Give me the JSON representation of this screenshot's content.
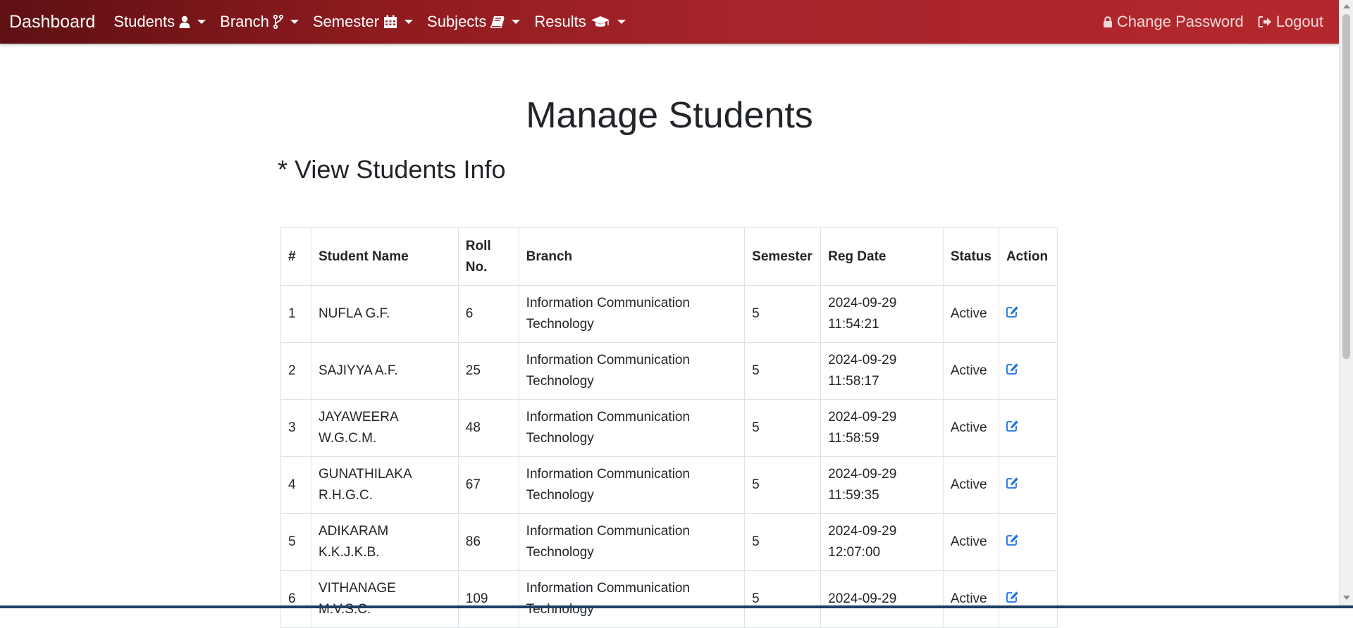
{
  "navbar": {
    "brand": "Dashboard",
    "menus": [
      {
        "label": "Students",
        "icon": "user-icon"
      },
      {
        "label": "Branch",
        "icon": "code-branch-icon"
      },
      {
        "label": "Semester",
        "icon": "calendar-icon"
      },
      {
        "label": "Subjects",
        "icon": "book-icon"
      },
      {
        "label": "Results",
        "icon": "graduation-cap-icon"
      }
    ],
    "change_password": "Change Password",
    "logout": "Logout"
  },
  "page": {
    "title": "Manage Students",
    "subtitle": "* View Students Info"
  },
  "table": {
    "headers": [
      "#",
      "Student Name",
      "Roll No.",
      "Branch",
      "Semester",
      "Reg Date",
      "Status",
      "Action"
    ],
    "rows": [
      {
        "num": "1",
        "name": "NUFLA G.F.",
        "roll": "6",
        "branch": "Information Communication Technology",
        "semester": "5",
        "reg_date": "2024-09-29 11:54:21",
        "status": "Active"
      },
      {
        "num": "2",
        "name": "SAJIYYA A.F.",
        "roll": "25",
        "branch": "Information Communication Technology",
        "semester": "5",
        "reg_date": "2024-09-29 11:58:17",
        "status": "Active"
      },
      {
        "num": "3",
        "name": "JAYAWEERA W.G.C.M.",
        "roll": "48",
        "branch": "Information Communication Technology",
        "semester": "5",
        "reg_date": "2024-09-29 11:58:59",
        "status": "Active"
      },
      {
        "num": "4",
        "name": "GUNATHILAKA R.H.G.C.",
        "roll": "67",
        "branch": "Information Communication Technology",
        "semester": "5",
        "reg_date": "2024-09-29 11:59:35",
        "status": "Active"
      },
      {
        "num": "5",
        "name": "ADIKARAM K.K.J.K.B.",
        "roll": "86",
        "branch": "Information Communication Technology",
        "semester": "5",
        "reg_date": "2024-09-29 12:07:00",
        "status": "Active"
      },
      {
        "num": "6",
        "name": "VITHANAGE M.V.S.C.",
        "roll": "109",
        "branch": "Information Communication Technology",
        "semester": "5",
        "reg_date": "2024-09-29",
        "status": "Active"
      }
    ]
  },
  "colors": {
    "navbar_dark": "#5e1013",
    "navbar_light": "#b4282d",
    "edit_icon": "#1a73e8"
  }
}
